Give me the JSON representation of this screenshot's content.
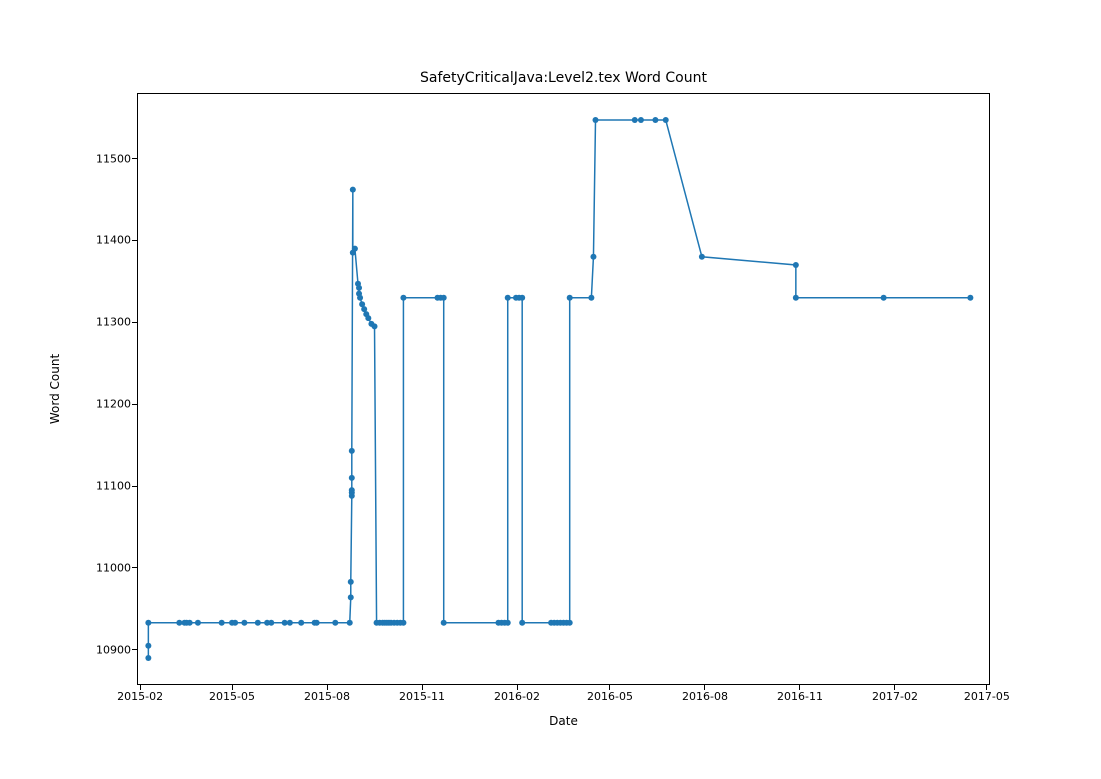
{
  "chart_data": {
    "type": "line",
    "title": "SafetyCriticalJava:Level2.tex Word Count",
    "xlabel": "Date",
    "ylabel": "Word Count",
    "xlim_days": [
      736003,
      736829
    ],
    "ylim": [
      10857,
      11580
    ],
    "xticks": [
      {
        "day": 736006,
        "label": "2015-02"
      },
      {
        "day": 736095,
        "label": "2015-05"
      },
      {
        "day": 736187,
        "label": "2015-08"
      },
      {
        "day": 736279,
        "label": "2015-11"
      },
      {
        "day": 736371,
        "label": "2016-02"
      },
      {
        "day": 736461,
        "label": "2016-05"
      },
      {
        "day": 736553,
        "label": "2016-08"
      },
      {
        "day": 736645,
        "label": "2016-11"
      },
      {
        "day": 736737,
        "label": "2017-02"
      },
      {
        "day": 736826,
        "label": "2017-05"
      }
    ],
    "yticks": [
      10900,
      11000,
      11100,
      11200,
      11300,
      11400,
      11500
    ],
    "series": [
      {
        "name": "Word Count",
        "color": "#1f77b4",
        "points": [
          {
            "day": 736014,
            "value": 10890
          },
          {
            "day": 736014,
            "value": 10905
          },
          {
            "day": 736014,
            "value": 10933
          },
          {
            "day": 736044,
            "value": 10933
          },
          {
            "day": 736049,
            "value": 10933
          },
          {
            "day": 736051,
            "value": 10933
          },
          {
            "day": 736054,
            "value": 10933
          },
          {
            "day": 736062,
            "value": 10933
          },
          {
            "day": 736085,
            "value": 10933
          },
          {
            "day": 736095,
            "value": 10933
          },
          {
            "day": 736098,
            "value": 10933
          },
          {
            "day": 736107,
            "value": 10933
          },
          {
            "day": 736120,
            "value": 10933
          },
          {
            "day": 736129,
            "value": 10933
          },
          {
            "day": 736133,
            "value": 10933
          },
          {
            "day": 736146,
            "value": 10933
          },
          {
            "day": 736151,
            "value": 10933
          },
          {
            "day": 736162,
            "value": 10933
          },
          {
            "day": 736175,
            "value": 10933
          },
          {
            "day": 736177,
            "value": 10933
          },
          {
            "day": 736195,
            "value": 10933
          },
          {
            "day": 736209,
            "value": 10933
          },
          {
            "day": 736210,
            "value": 10964
          },
          {
            "day": 736210,
            "value": 10983
          },
          {
            "day": 736211,
            "value": 11088
          },
          {
            "day": 736211,
            "value": 11092
          },
          {
            "day": 736211,
            "value": 11095
          },
          {
            "day": 736211,
            "value": 11110
          },
          {
            "day": 736211,
            "value": 11143
          },
          {
            "day": 736212,
            "value": 11462
          },
          {
            "day": 736212,
            "value": 11385
          },
          {
            "day": 736214,
            "value": 11390
          },
          {
            "day": 736217,
            "value": 11347
          },
          {
            "day": 736218,
            "value": 11342
          },
          {
            "day": 736218,
            "value": 11335
          },
          {
            "day": 736219,
            "value": 11330
          },
          {
            "day": 736221,
            "value": 11322
          },
          {
            "day": 736223,
            "value": 11316
          },
          {
            "day": 736225,
            "value": 11310
          },
          {
            "day": 736227,
            "value": 11305
          },
          {
            "day": 736230,
            "value": 11298
          },
          {
            "day": 736233,
            "value": 11295
          },
          {
            "day": 736235,
            "value": 10933
          },
          {
            "day": 736238,
            "value": 10933
          },
          {
            "day": 736241,
            "value": 10933
          },
          {
            "day": 736243,
            "value": 10933
          },
          {
            "day": 736245,
            "value": 10933
          },
          {
            "day": 736247,
            "value": 10933
          },
          {
            "day": 736249,
            "value": 10933
          },
          {
            "day": 736252,
            "value": 10933
          },
          {
            "day": 736255,
            "value": 10933
          },
          {
            "day": 736258,
            "value": 10933
          },
          {
            "day": 736261,
            "value": 10933
          },
          {
            "day": 736261,
            "value": 11330
          },
          {
            "day": 736294,
            "value": 11330
          },
          {
            "day": 736297,
            "value": 11330
          },
          {
            "day": 736300,
            "value": 11330
          },
          {
            "day": 736300,
            "value": 10933
          },
          {
            "day": 736353,
            "value": 10933
          },
          {
            "day": 736356,
            "value": 10933
          },
          {
            "day": 736359,
            "value": 10933
          },
          {
            "day": 736362,
            "value": 10933
          },
          {
            "day": 736362,
            "value": 11330
          },
          {
            "day": 736370,
            "value": 11330
          },
          {
            "day": 736373,
            "value": 11330
          },
          {
            "day": 736376,
            "value": 11330
          },
          {
            "day": 736376,
            "value": 10933
          },
          {
            "day": 736404,
            "value": 10933
          },
          {
            "day": 736407,
            "value": 10933
          },
          {
            "day": 736410,
            "value": 10933
          },
          {
            "day": 736413,
            "value": 10933
          },
          {
            "day": 736416,
            "value": 10933
          },
          {
            "day": 736419,
            "value": 10933
          },
          {
            "day": 736422,
            "value": 10933
          },
          {
            "day": 736422,
            "value": 11330
          },
          {
            "day": 736443,
            "value": 11330
          },
          {
            "day": 736445,
            "value": 11380
          },
          {
            "day": 736447,
            "value": 11547
          },
          {
            "day": 736485,
            "value": 11547
          },
          {
            "day": 736491,
            "value": 11547
          },
          {
            "day": 736505,
            "value": 11547
          },
          {
            "day": 736515,
            "value": 11547
          },
          {
            "day": 736550,
            "value": 11380
          },
          {
            "day": 736641,
            "value": 11370
          },
          {
            "day": 736641,
            "value": 11330
          },
          {
            "day": 736726,
            "value": 11330
          },
          {
            "day": 736810,
            "value": 11330
          }
        ]
      }
    ]
  }
}
